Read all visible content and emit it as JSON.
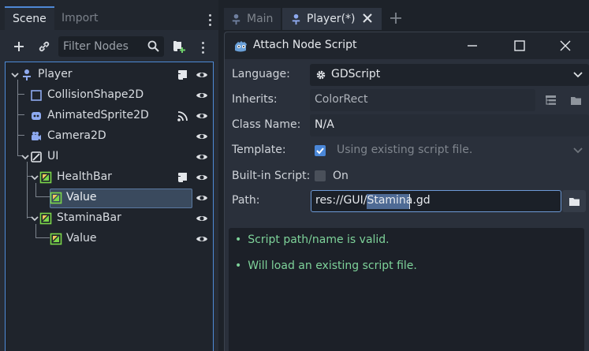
{
  "scene_dock": {
    "tabs": [
      {
        "label": "Scene",
        "active": true
      },
      {
        "label": "Import",
        "active": false
      }
    ],
    "filter_placeholder": "Filter Nodes",
    "tree": [
      {
        "label": "Player",
        "icon": "node2d-person-icon",
        "expanded": true,
        "extra_icon": "script-icon",
        "visible_icon": "eye-icon"
      },
      {
        "label": "CollisionShape2D",
        "icon": "collision-shape-icon",
        "visible_icon": "eye-icon"
      },
      {
        "label": "AnimatedSprite2D",
        "icon": "animated-sprite-icon",
        "extra_icon": "signal-icon",
        "visible_icon": "eye-icon"
      },
      {
        "label": "Camera2D",
        "icon": "camera-icon",
        "visible_icon": "eye-icon"
      },
      {
        "label": "UI",
        "icon": "control-icon",
        "expanded": true,
        "visible_icon": "eye-icon"
      },
      {
        "label": "HealthBar",
        "icon": "color-rect-icon",
        "expanded": true,
        "extra_icon": "script-icon",
        "visible_icon": "eye-icon"
      },
      {
        "label": "Value",
        "icon": "color-rect-icon",
        "selected": true,
        "visible_icon": "eye-icon"
      },
      {
        "label": "StaminaBar",
        "icon": "color-rect-icon",
        "expanded": true,
        "visible_icon": "eye-icon"
      },
      {
        "label": "Value",
        "icon": "color-rect-icon",
        "visible_icon": "eye-icon"
      }
    ]
  },
  "editor_tabs": [
    {
      "label": "Main",
      "active": false
    },
    {
      "label": "Player(*)",
      "active": true
    }
  ],
  "dialog": {
    "title": "Attach Node Script",
    "language": {
      "label": "Language:",
      "value": "GDScript"
    },
    "inherits": {
      "label": "Inherits:",
      "value": "ColorRect"
    },
    "class_name": {
      "label": "Class Name:",
      "value": "N/A"
    },
    "template": {
      "label": "Template:",
      "checked": true,
      "value": "Using existing script file."
    },
    "builtin": {
      "label": "Built-in Script:",
      "checked": false,
      "value": "On"
    },
    "path": {
      "label": "Path:",
      "prefix": "res://GUI/",
      "selected": "Stamina",
      "suffix": ".gd"
    },
    "status_bullet": "•",
    "status": [
      "Script path/name is valid.",
      "Will load an existing script file."
    ]
  },
  "colors": {
    "accent": "#4e8bd8",
    "status_ok": "#7ed39a",
    "color_rect_green": "#7bd64a"
  }
}
